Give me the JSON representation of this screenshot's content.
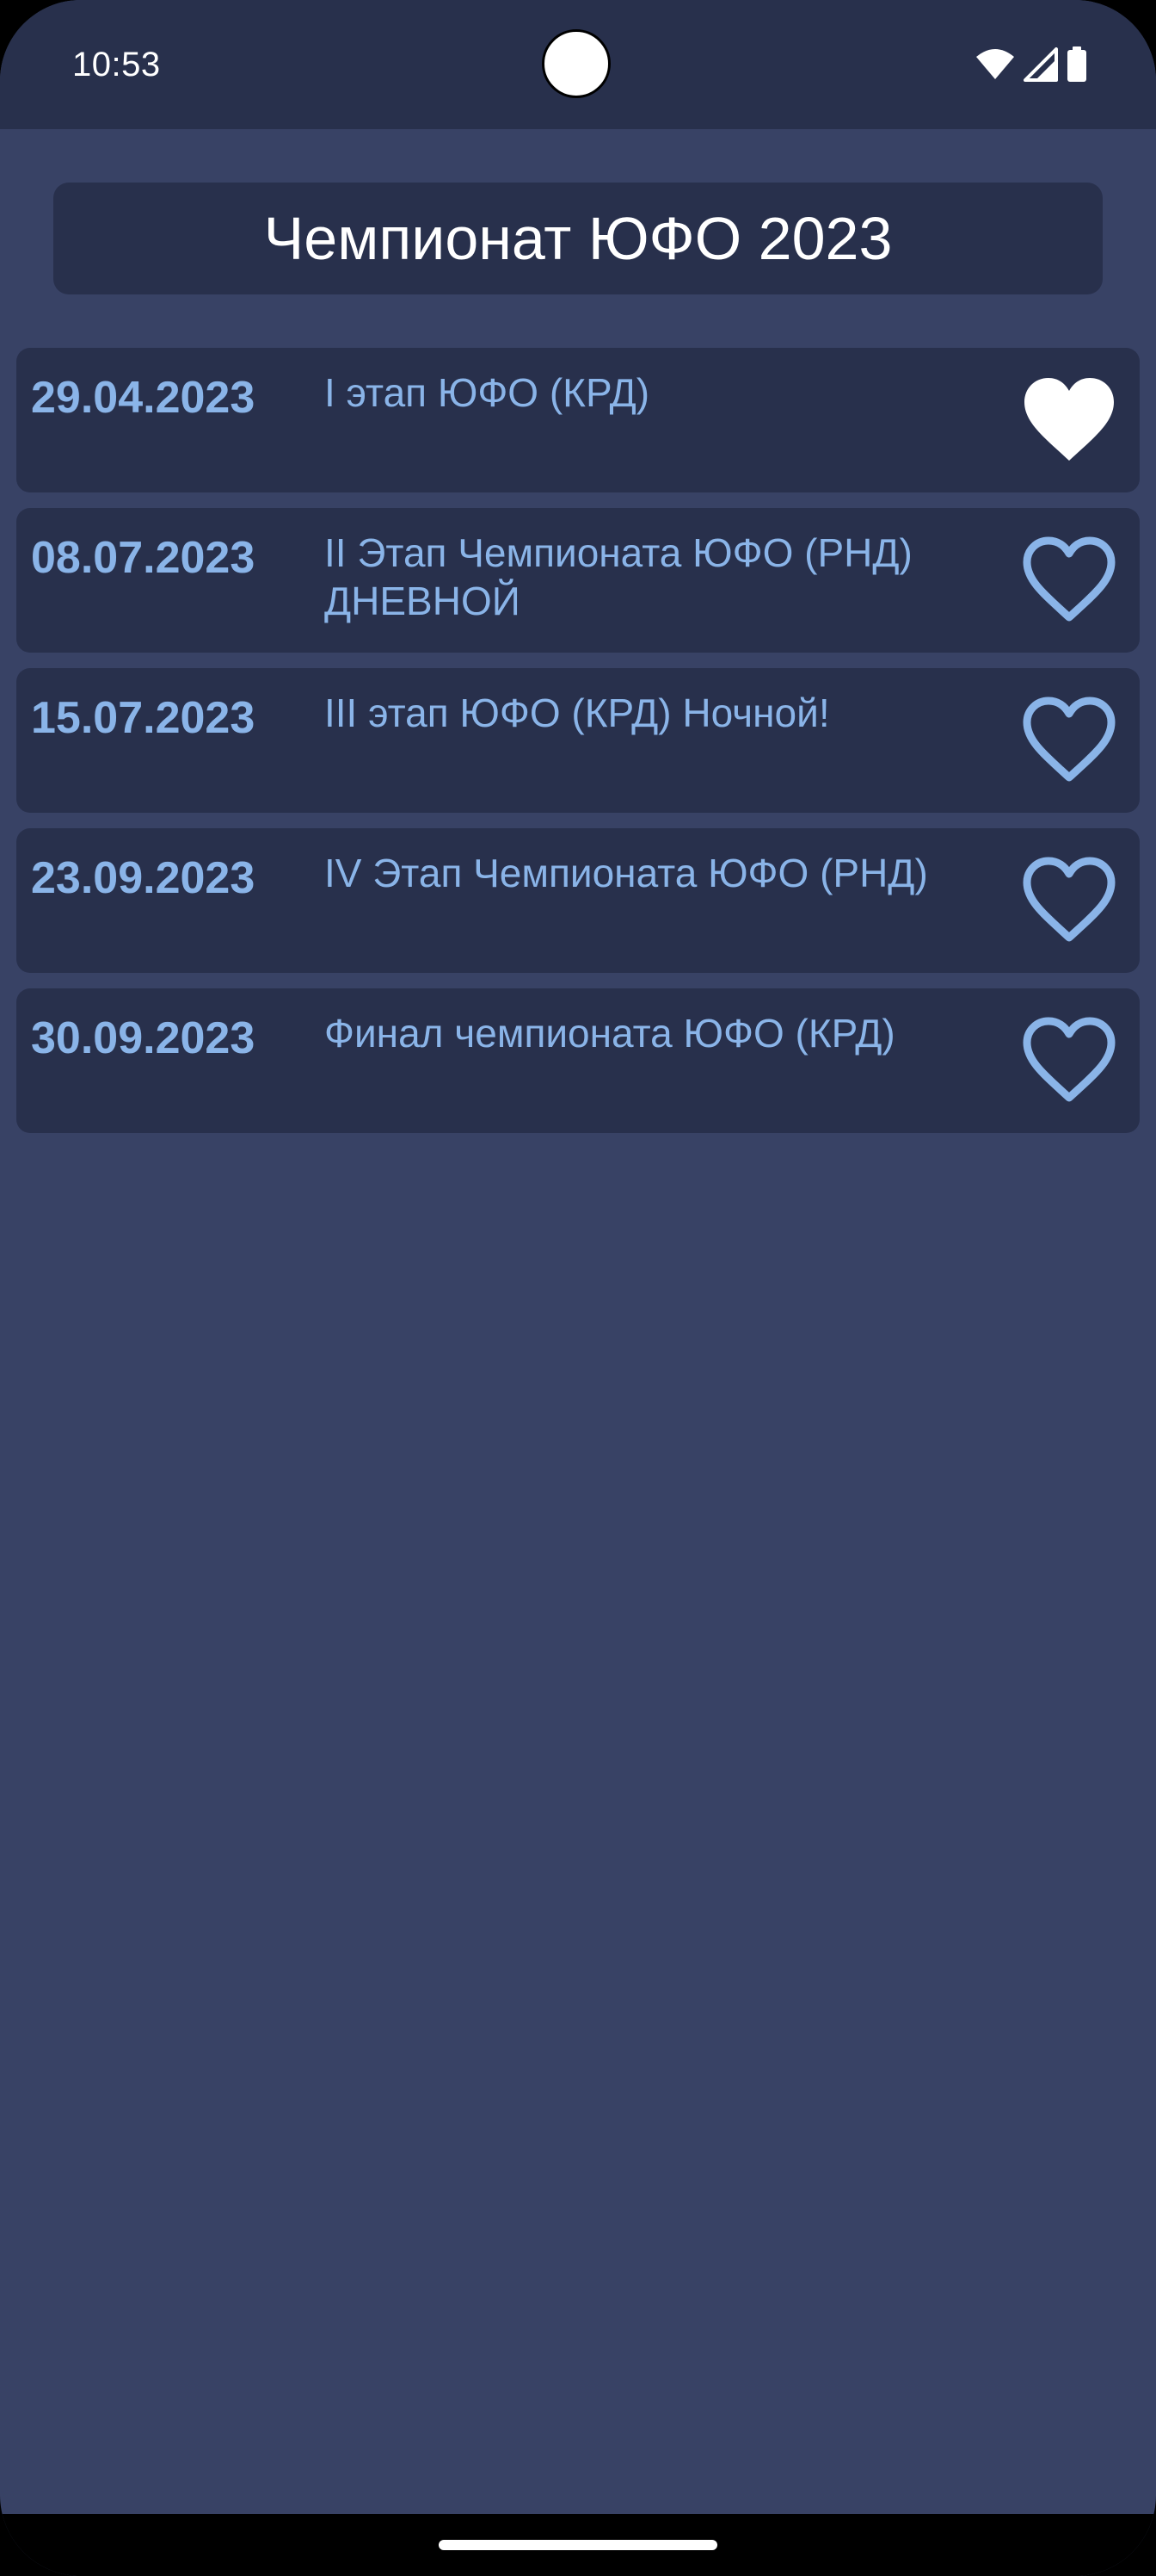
{
  "status_bar": {
    "time": "10:53",
    "icons": [
      "wifi-icon",
      "cellular-signal-icon",
      "battery-icon"
    ]
  },
  "header": {
    "title": "Чемпионат ЮФО 2023"
  },
  "events": [
    {
      "date": "29.04.2023",
      "name": "I этап ЮФО (КРД)",
      "favorite": true
    },
    {
      "date": "08.07.2023",
      "name": "II Этап Чемпионата ЮФО (РНД) ДНЕВНОЙ",
      "favorite": false
    },
    {
      "date": "15.07.2023",
      "name": "III этап ЮФО (КРД) Ночной!",
      "favorite": false
    },
    {
      "date": "23.09.2023",
      "name": "IV Этап Чемпионата ЮФО (РНД)",
      "favorite": false
    },
    {
      "date": "30.09.2023",
      "name": "Финал чемпионата ЮФО (КРД)",
      "favorite": false
    }
  ],
  "colors": {
    "background": "#384265",
    "card": "#28304c",
    "accent": "#8ab4e8",
    "favorite_filled": "#ffffff"
  }
}
